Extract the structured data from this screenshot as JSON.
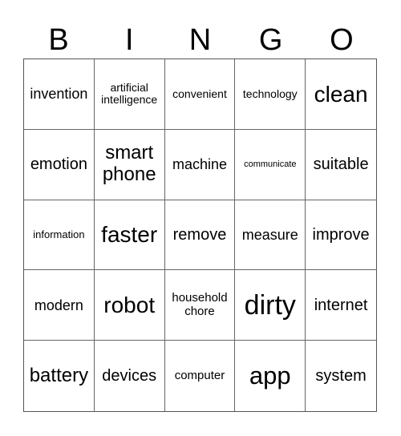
{
  "header": [
    "B",
    "I",
    "N",
    "G",
    "O"
  ],
  "cells": [
    "invention",
    "artificial intelligence",
    "convenient",
    "technology",
    "clean",
    "emotion",
    "smart phone",
    "machine",
    "communicate",
    "suitable",
    "information",
    "faster",
    "remove",
    "measure",
    "improve",
    "modern",
    "robot",
    "household chore",
    "dirty",
    "internet",
    "battery",
    "devices",
    "computer",
    "app",
    "system"
  ]
}
